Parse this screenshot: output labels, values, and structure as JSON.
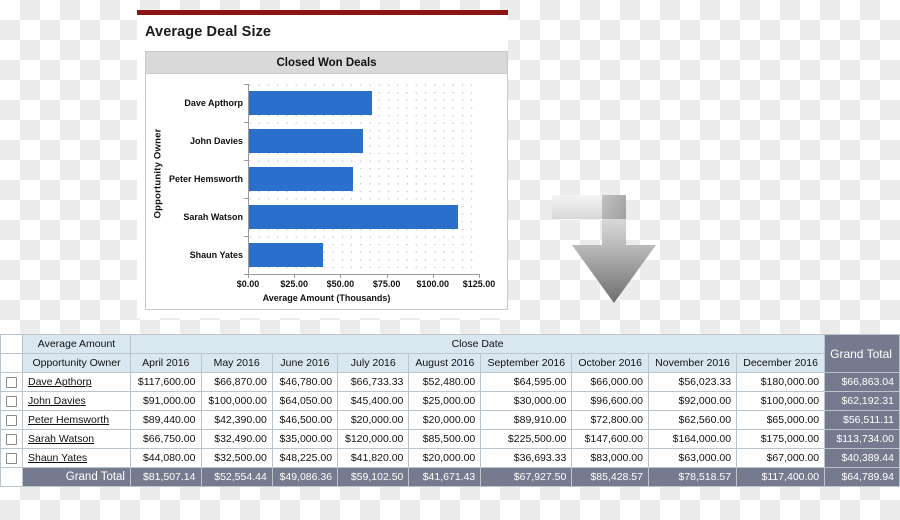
{
  "report": {
    "title": "Average Deal Size",
    "accent_rule_color": "#8b1512"
  },
  "chart_data": {
    "type": "bar",
    "orientation": "horizontal",
    "title": "Closed Won Deals",
    "xlabel": "Average Amount (Thousands)",
    "ylabel": "Opportunity Owner",
    "categories": [
      "Dave Apthorp",
      "John Davies",
      "Peter Hemsworth",
      "Sarah Watson",
      "Shaun Yates"
    ],
    "values": [
      66.863,
      62.192,
      56.511,
      113.734,
      40.389
    ],
    "xlim": [
      0,
      125
    ],
    "xticks": [
      0,
      25,
      50,
      75,
      100,
      125
    ],
    "xtick_labels": [
      "$0.00",
      "$25.00",
      "$50.00",
      "$75.00",
      "$100.00",
      "$125.00"
    ],
    "grid": true,
    "legend": "none",
    "bar_color": "#2a6fc9"
  },
  "arrow": {
    "name": "bent-down-arrow",
    "color_light": "#efefef",
    "color_dark": "#6e6e6e"
  },
  "table": {
    "corner_label_top": "Average Amount",
    "corner_label_bottom": "Opportunity Owner",
    "column_group_label": "Close Date",
    "grand_total_col_label": "Grand Total",
    "grand_total_row_label": "Grand Total",
    "month_headers": [
      "April 2016",
      "May 2016",
      "June 2016",
      "July 2016",
      "August 2016",
      "September 2016",
      "October 2016",
      "November 2016",
      "December 2016"
    ],
    "rows": [
      {
        "owner": "Dave Apthorp",
        "values": [
          "$117,600.00",
          "$66,870.00",
          "$46,780.00",
          "$66,733.33",
          "$52,480.00",
          "$64,595.00",
          "$66,000.00",
          "$56,023.33",
          "$180,000.00"
        ],
        "grand_total": "$66,863.04"
      },
      {
        "owner": "John Davies",
        "values": [
          "$91,000.00",
          "$100,000.00",
          "$64,050.00",
          "$45,400.00",
          "$25,000.00",
          "$30,000.00",
          "$96,600.00",
          "$92,000.00",
          "$100,000.00"
        ],
        "grand_total": "$62,192.31"
      },
      {
        "owner": "Peter Hemsworth",
        "values": [
          "$89,440.00",
          "$42,390.00",
          "$46,500.00",
          "$20,000.00",
          "$20,000.00",
          "$89,910.00",
          "$72,800.00",
          "$62,560.00",
          "$65,000.00"
        ],
        "grand_total": "$56,511.11"
      },
      {
        "owner": "Sarah Watson",
        "values": [
          "$66,750.00",
          "$32,490.00",
          "$35,000.00",
          "$120,000.00",
          "$85,500.00",
          "$225,500.00",
          "$147,600.00",
          "$164,000.00",
          "$175,000.00"
        ],
        "grand_total": "$113,734.00"
      },
      {
        "owner": "Shaun Yates",
        "values": [
          "$44,080.00",
          "$32,500.00",
          "$48,225.00",
          "$41,820.00",
          "$20,000.00",
          "$36,693.33",
          "$83,000.00",
          "$63,000.00",
          "$67,000.00"
        ],
        "grand_total": "$40,389.44"
      }
    ],
    "grand_total_row": {
      "values": [
        "$81,507.14",
        "$52,554.44",
        "$49,086.36",
        "$59,102.50",
        "$41,671.43",
        "$67,927.50",
        "$85,428.57",
        "$78,518.57",
        "$117,400.00"
      ],
      "grand_total": "$64,789.94"
    }
  }
}
